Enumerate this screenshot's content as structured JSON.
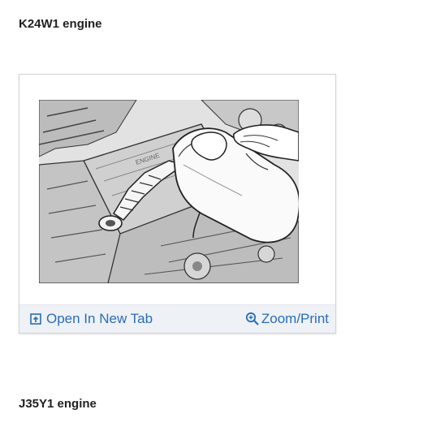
{
  "sections": [
    {
      "heading": "K24W1 engine"
    },
    {
      "heading": "J35Y1 engine"
    }
  ],
  "figure": {
    "open_tab_label": "Open In New Tab",
    "zoom_print_label": "Zoom/Print",
    "icons": {
      "open": "open-in-new-tab-icon",
      "zoom": "zoom-in-icon"
    },
    "colors": {
      "link": "#2c6eb5",
      "action_bar": "#eef1f6",
      "heading": "#222222"
    }
  }
}
